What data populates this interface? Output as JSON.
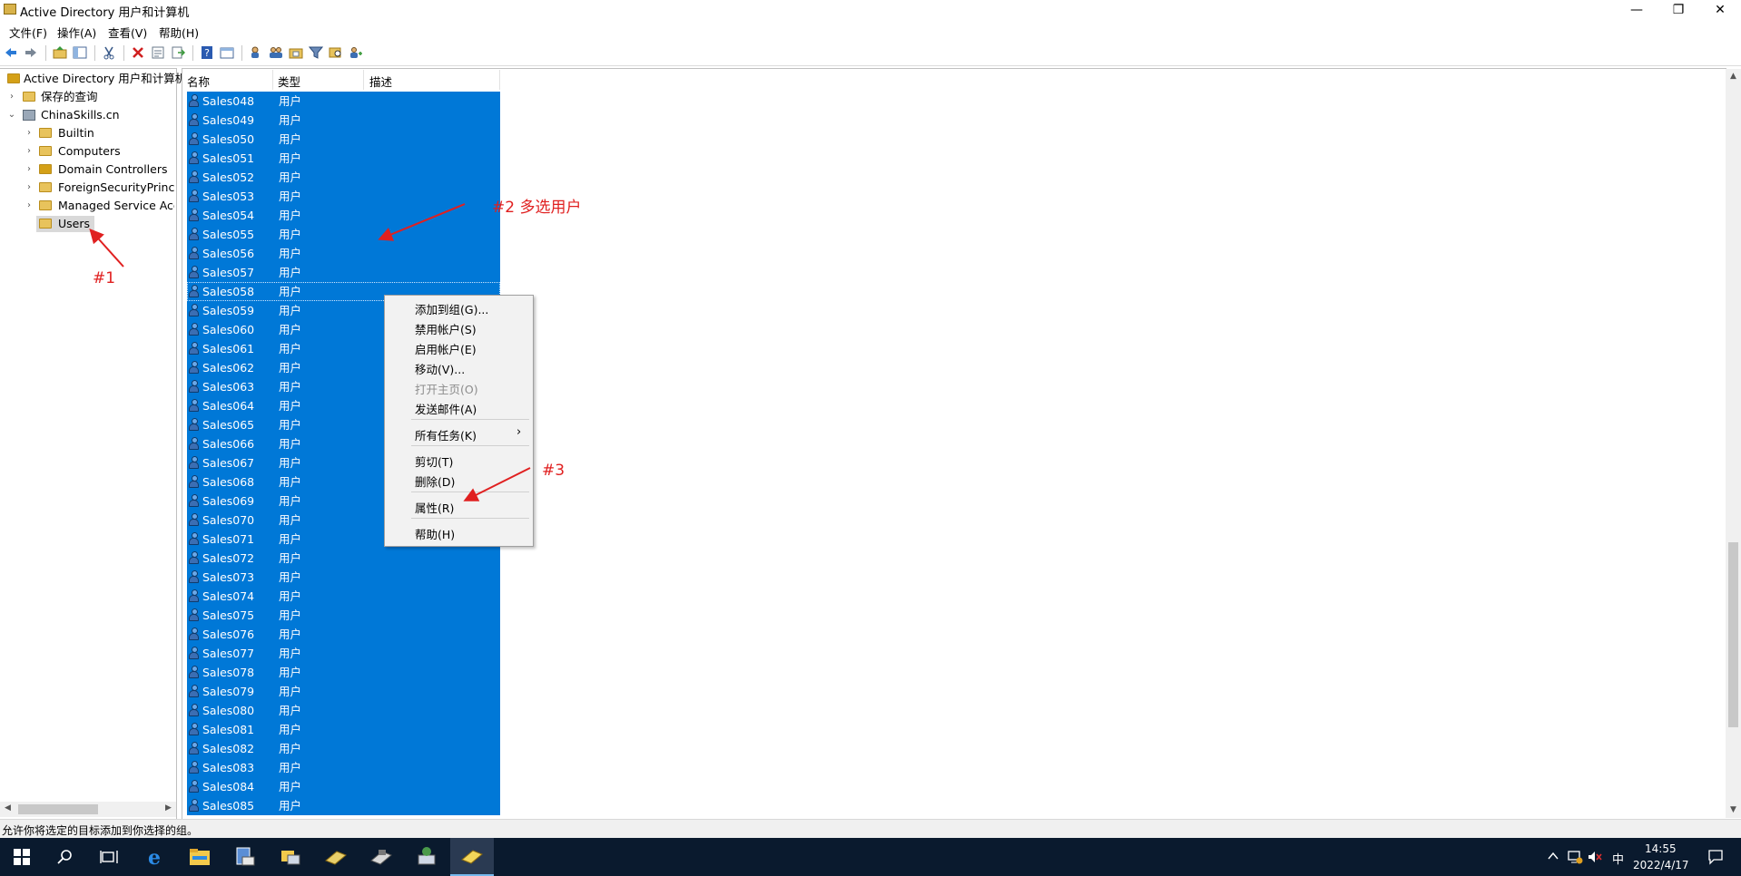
{
  "window": {
    "title": "Active Directory 用户和计算机",
    "minimize_glyph": "—",
    "maximize_glyph": "❐",
    "close_glyph": "✕"
  },
  "menubar": {
    "items": [
      "文件(F)",
      "操作(A)",
      "查看(V)",
      "帮助(H)"
    ]
  },
  "toolbar": {
    "icons": [
      "back-arrow-icon",
      "forward-arrow-icon",
      "up-folder-icon",
      "show-hide-tree-icon",
      "cut-icon",
      "delete-icon",
      "properties-icon",
      "export-icon",
      "help-icon",
      "console-icon",
      "new-user-icon",
      "new-group-icon",
      "new-ou-icon",
      "filter-icon",
      "find-icon",
      "add-to-group-icon"
    ]
  },
  "tree": {
    "root_label": "Active Directory 用户和计算机",
    "saved_queries": "保存的查询",
    "domain": "ChinaSkills.cn",
    "children": [
      "Builtin",
      "Computers",
      "Domain Controllers",
      "ForeignSecurityPrincipals",
      "Managed Service Accounts",
      "Users"
    ]
  },
  "list": {
    "columns": [
      "名称",
      "类型",
      "描述"
    ],
    "type_value": "用户",
    "rows": [
      "Sales048",
      "Sales049",
      "Sales050",
      "Sales051",
      "Sales052",
      "Sales053",
      "Sales054",
      "Sales055",
      "Sales056",
      "Sales057",
      "Sales058",
      "Sales059",
      "Sales060",
      "Sales061",
      "Sales062",
      "Sales063",
      "Sales064",
      "Sales065",
      "Sales066",
      "Sales067",
      "Sales068",
      "Sales069",
      "Sales070",
      "Sales071",
      "Sales072",
      "Sales073",
      "Sales074",
      "Sales075",
      "Sales076",
      "Sales077",
      "Sales078",
      "Sales079",
      "Sales080",
      "Sales081",
      "Sales082",
      "Sales083",
      "Sales084",
      "Sales085"
    ],
    "focused_row": "Sales058"
  },
  "context_menu": {
    "add_to_group": "添加到组(G)...",
    "disable_account": "禁用帐户(S)",
    "enable_account": "启用帐户(E)",
    "move": "移动(V)...",
    "open_home_page": "打开主页(O)",
    "send_mail": "发送邮件(A)",
    "all_tasks": "所有任务(K)",
    "cut": "剪切(T)",
    "delete": "删除(D)",
    "properties": "属性(R)",
    "help": "帮助(H)"
  },
  "annotations": {
    "step1": "#1",
    "step2": "#2 多选用户",
    "step3": "#3",
    "color": "#e02020"
  },
  "statusbar": {
    "text": "允许你将选定的目标添加到你选择的组。"
  },
  "taskbar": {
    "apps": [
      "start-icon",
      "search-icon",
      "task-view-icon",
      "internet-explorer-icon",
      "file-explorer-icon",
      "server-manager-icon",
      "ad-users-computers-icon",
      "ad-domains-icon",
      "ad-sites-icon",
      "dns-icon",
      "active-console-icon"
    ],
    "ime": "中",
    "time": "14:55",
    "date": "2022/4/17"
  },
  "colors": {
    "selection": "#0078d7",
    "taskbar": "#0a1a2e",
    "annotation": "#e02020"
  }
}
